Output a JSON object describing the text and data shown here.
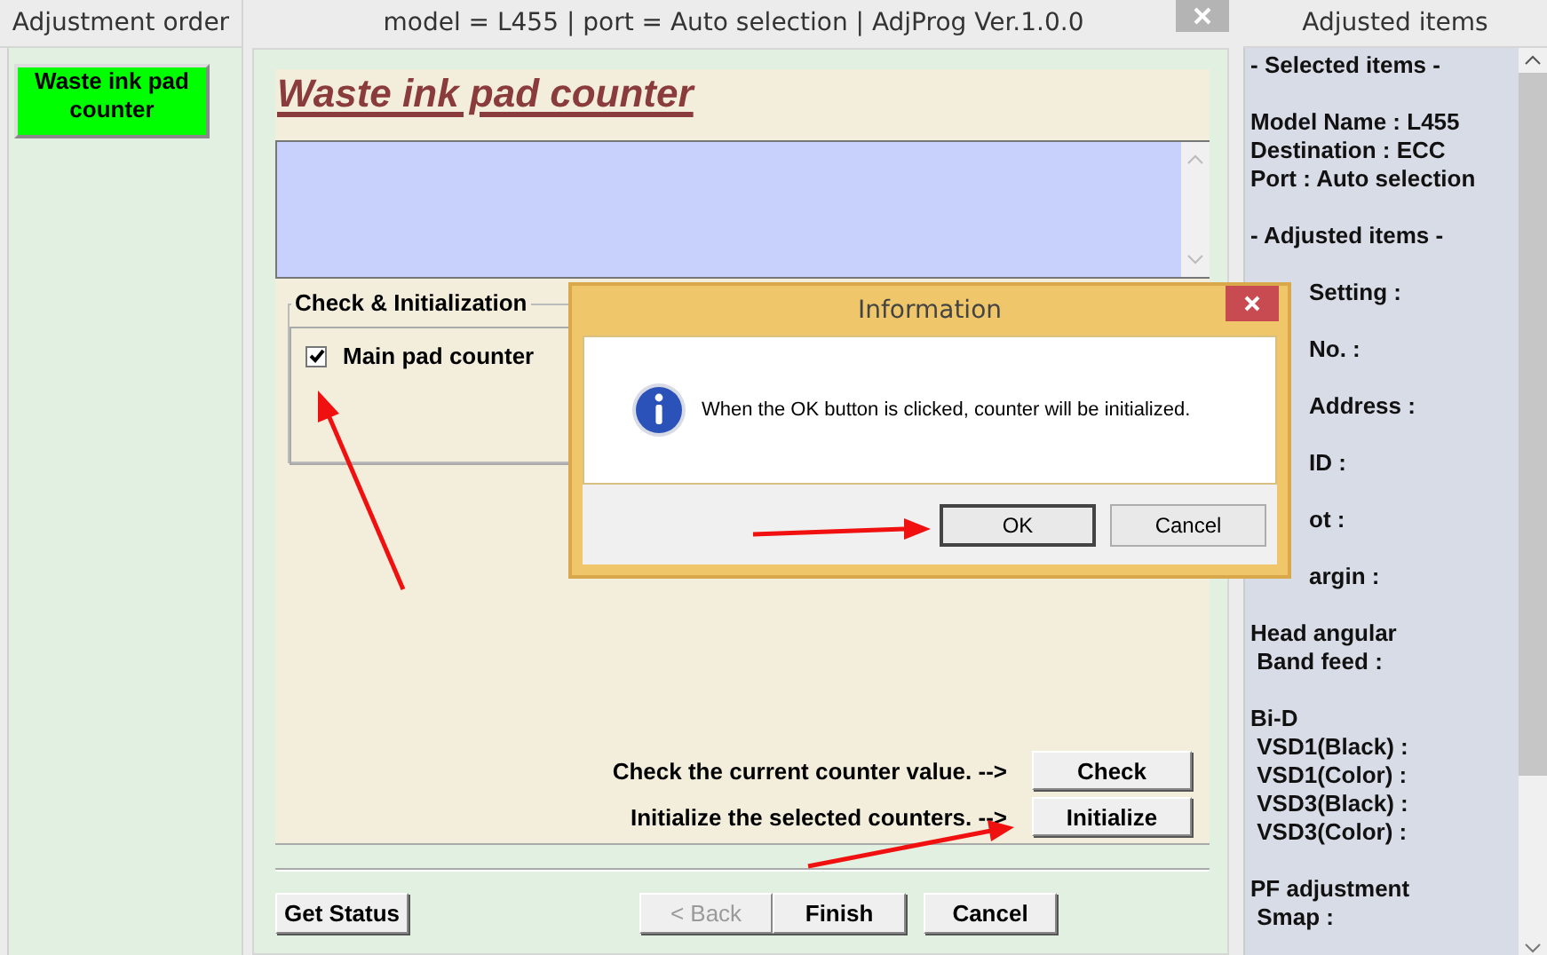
{
  "left_panel": {
    "header": "Adjustment order",
    "items": [
      {
        "label": "Waste ink pad counter",
        "selected": true
      }
    ]
  },
  "window": {
    "title": "model = L455 | port = Auto selection | AdjProg Ver.1.0.0"
  },
  "page": {
    "heading": "Waste ink pad counter",
    "group": {
      "title": "Check & Initialization",
      "checkboxes": [
        {
          "label": "Main pad counter",
          "checked": true
        }
      ]
    },
    "actions": [
      {
        "prompt": "Check the current counter value. -->",
        "button": "Check"
      },
      {
        "prompt": "Initialize the selected counters. -->",
        "button": "Initialize"
      }
    ]
  },
  "footer": {
    "status_button": "Get Status",
    "buttons": [
      {
        "label": "< Back",
        "disabled": true
      },
      {
        "label": "Finish",
        "disabled": false
      },
      {
        "label": "Cancel",
        "disabled": false
      }
    ]
  },
  "right_panel": {
    "header": "Adjusted items",
    "groups": [
      {
        "kind": "text",
        "lines": [
          "- Selected items -"
        ]
      },
      {
        "kind": "text",
        "lines": [
          "Model Name : L455",
          "Destination : ECC",
          "Port : Auto selection"
        ]
      },
      {
        "kind": "text",
        "lines": [
          "- Adjusted items -"
        ]
      },
      {
        "kind": "partial",
        "lines": [
          "Setting :"
        ]
      },
      {
        "kind": "partial",
        "lines": [
          "No. :"
        ]
      },
      {
        "kind": "partial",
        "lines": [
          "Address :"
        ]
      },
      {
        "kind": "partial",
        "lines": [
          "ID :"
        ]
      },
      {
        "kind": "partial",
        "lines": [
          "ot :"
        ]
      },
      {
        "kind": "partial",
        "lines": [
          "argin :"
        ]
      },
      {
        "kind": "text",
        "lines": [
          "Head angular",
          " Band feed :"
        ]
      },
      {
        "kind": "text",
        "lines": [
          "Bi-D",
          " VSD1(Black) :",
          " VSD1(Color) :",
          " VSD3(Black) :",
          " VSD3(Color) :"
        ]
      },
      {
        "kind": "text",
        "lines": [
          "PF adjustment",
          " Smap :"
        ]
      }
    ]
  },
  "dialog": {
    "title": "Information",
    "message": "When the OK button is clicked, counter will be initialized.",
    "buttons": [
      {
        "label": "OK",
        "selected": true
      },
      {
        "label": "Cancel",
        "selected": false
      }
    ]
  }
}
